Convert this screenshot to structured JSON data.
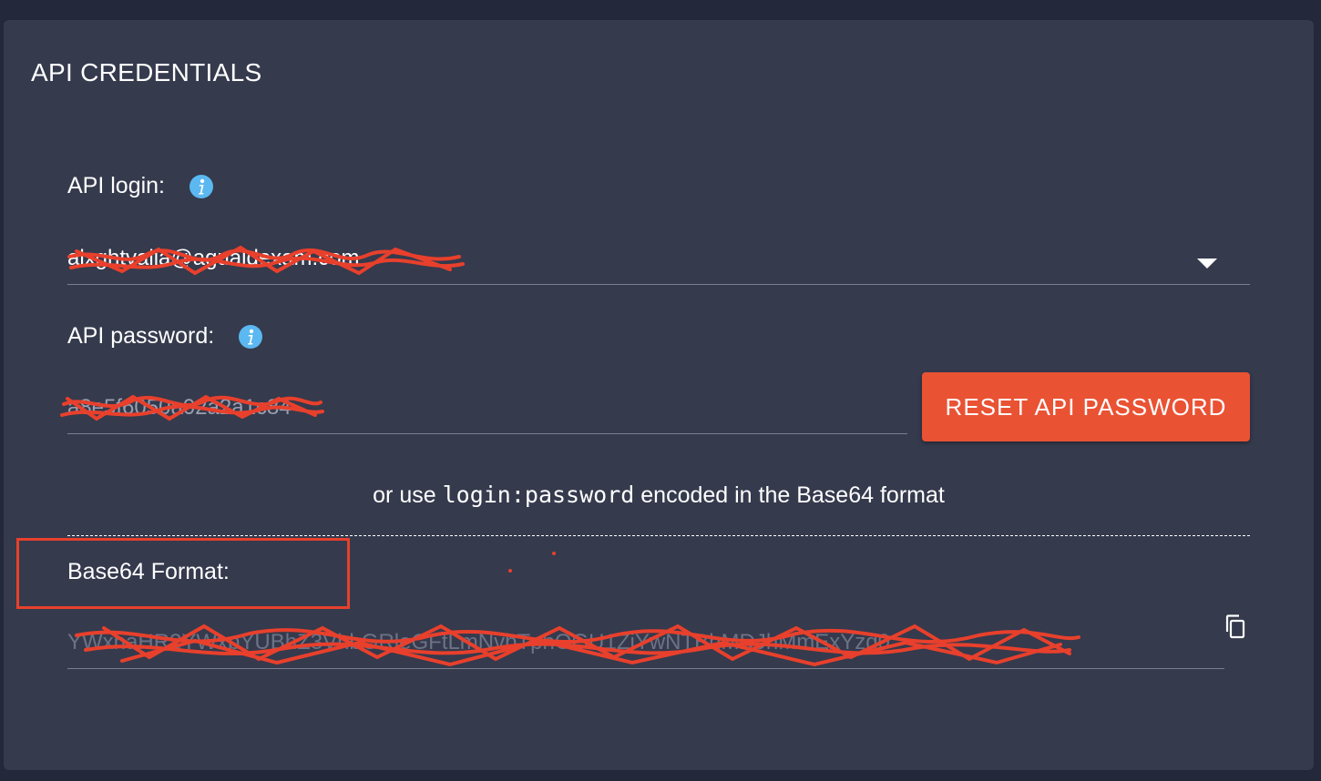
{
  "panel": {
    "title": "API CREDENTIALS"
  },
  "api_login": {
    "label": "API login:",
    "value": "alxghtvalia@agualdexam.com",
    "info_icon": "info-icon"
  },
  "api_password": {
    "label": "API password:",
    "value": "a8e5f6050a02a2a1c84",
    "info_icon": "info-icon"
  },
  "reset_button": {
    "label": "RESET API PASSWORD"
  },
  "hint": {
    "prefix": "or use ",
    "code": "login:password",
    "suffix": " encoded in the Base64 format"
  },
  "base64": {
    "label": "Base64 Format:",
    "value": "YWxnaHR2YWxpYUBhZ3VhbGRleGFtLmNvbTphOGU1ZjYwNTBhMDJhMmExYzg0",
    "copy_icon": "copy-icon"
  },
  "colors": {
    "background": "#23283a",
    "panel": "#353a4d",
    "accent": "#ea5234",
    "info": "#5bb8f0",
    "redaction": "#e8402c"
  }
}
